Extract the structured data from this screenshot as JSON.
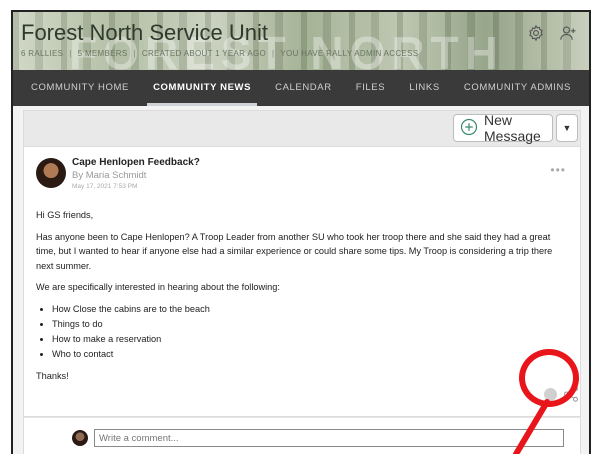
{
  "header": {
    "title": "Forest North Service Unit",
    "watermark": "FOREST NORTH",
    "meta": {
      "rallies": "6 RALLIES",
      "members": "5 MEMBERS",
      "created": "CREATED ABOUT 1 YEAR AGO",
      "access": "YOU HAVE RALLY ADMIN ACCESS"
    },
    "icons": [
      "gear-icon",
      "add-user-icon"
    ]
  },
  "nav": {
    "items": [
      "COMMUNITY HOME",
      "COMMUNITY NEWS",
      "CALENDAR",
      "FILES",
      "LINKS",
      "COMMUNITY ADMINS"
    ],
    "active": "COMMUNITY NEWS"
  },
  "toolbar": {
    "new_message_label": "New Message"
  },
  "post": {
    "title": "Cape Henlopen Feedback?",
    "author": "By Maria Schmidt",
    "date": "May 17, 2021 7:53 PM",
    "greeting": "Hi GS friends,",
    "paragraph1": "Has anyone been to Cape Henlopen? A Troop Leader from another SU who took her troop there and she said they had a great time, but I wanted to hear if anyone else had a similar experience or could share some tips. My Troop is considering a trip there next summer.",
    "paragraph2": "We are specifically interested in hearing about the following:",
    "list": [
      "How Close the cabins are to the beach",
      "Things to do",
      "How to make a reservation",
      "Who to contact"
    ],
    "closing": "Thanks!"
  },
  "comment": {
    "placeholder": "Write a comment..."
  },
  "colors": {
    "nav_bg": "#3a3a3a",
    "highlight": "#e8151b"
  }
}
